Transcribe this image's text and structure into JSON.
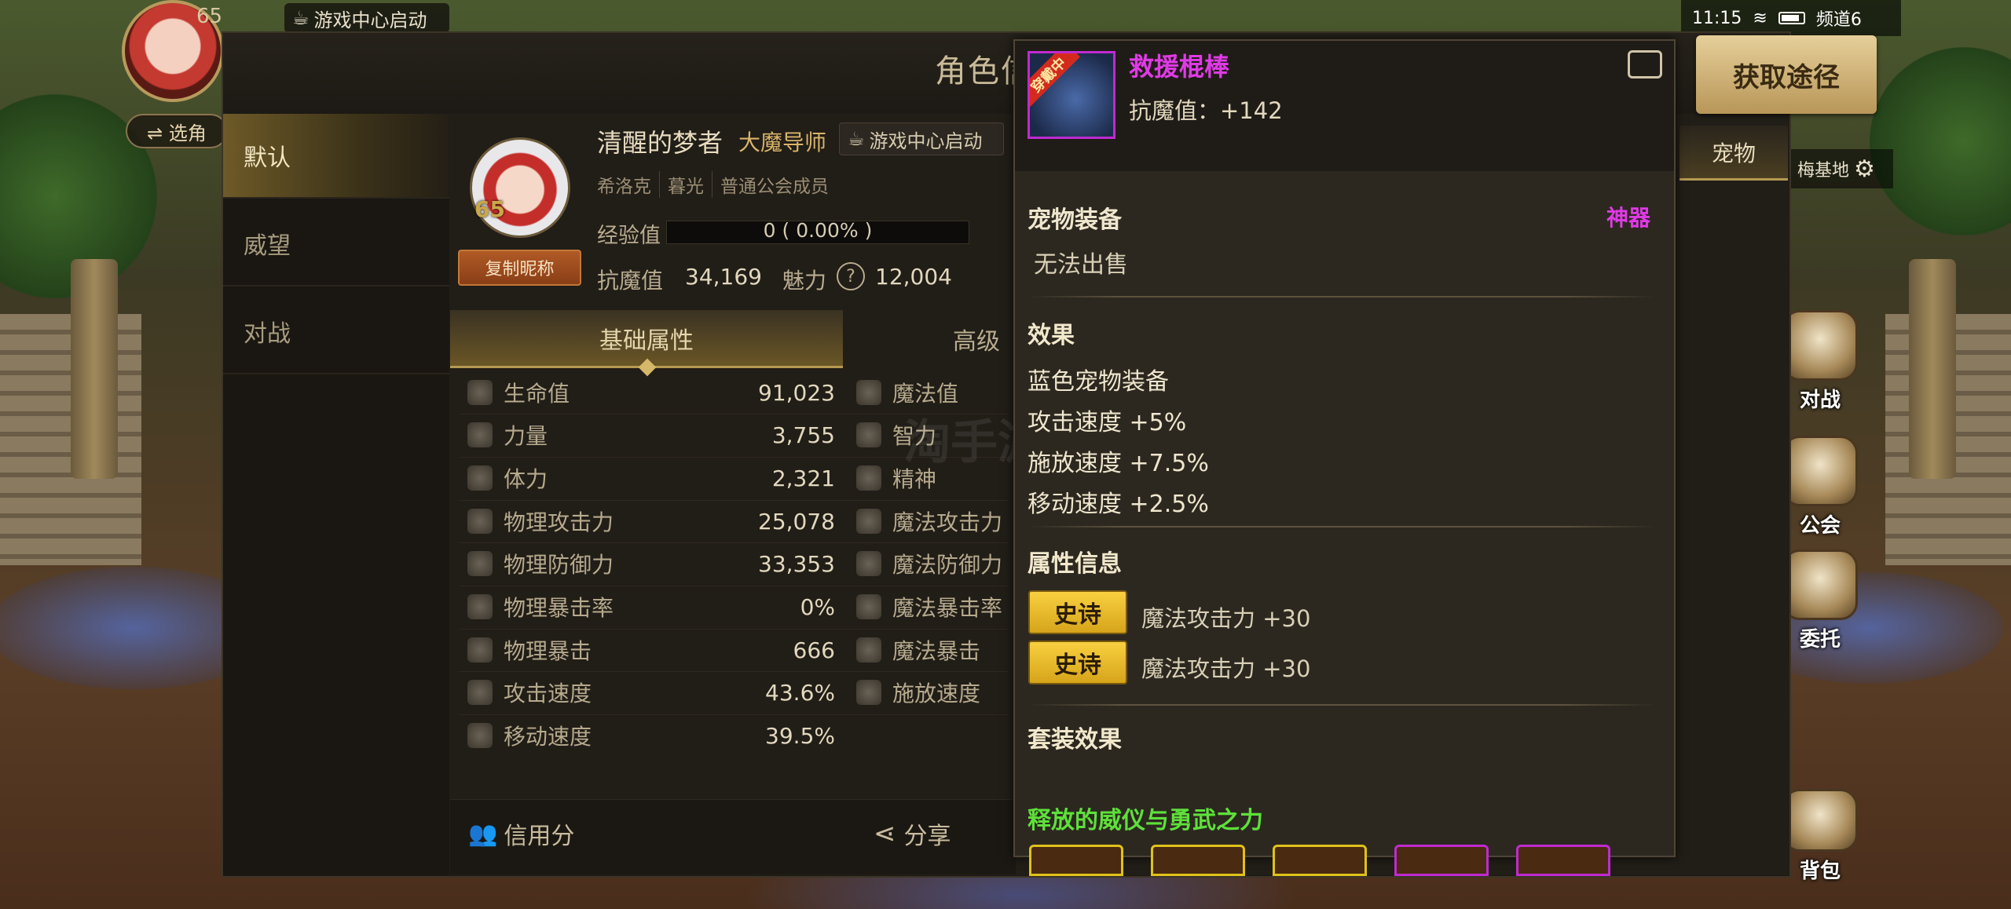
{
  "hud": {
    "level": "65",
    "game_center": "游戏中心启动",
    "select_role": "⇌ 选角"
  },
  "status": {
    "time": "11:15",
    "channel": "频道6"
  },
  "panel": {
    "title": "角色信"
  },
  "side_tabs": [
    {
      "label": "默认"
    },
    {
      "label": "威望"
    },
    {
      "label": "对战"
    }
  ],
  "character": {
    "level": "65",
    "name": "清醒的梦者",
    "class": "大魔导师",
    "game_center": "游戏中心启动",
    "server": "希洛克",
    "guild": "暮光",
    "guild_role": "普通公会成员",
    "copy_nick": "复制昵称",
    "exp_label": "经验值",
    "exp_value": "0 ( 0.00% )",
    "exp_progress": 0,
    "resistance_label": "抗魔值",
    "resistance_value": "34,169",
    "charm_label": "魅力",
    "charm_value": "12,004"
  },
  "attr_tabs": {
    "basic": "基础属性",
    "advanced": "高级"
  },
  "attributes_left": [
    {
      "label": "生命值",
      "value": "91,023"
    },
    {
      "label": "力量",
      "value": "3,755"
    },
    {
      "label": "体力",
      "value": "2,321"
    },
    {
      "label": "物理攻击力",
      "value": "25,078"
    },
    {
      "label": "物理防御力",
      "value": "33,353"
    },
    {
      "label": "物理暴击率",
      "value": "0%"
    },
    {
      "label": "物理暴击",
      "value": "666"
    },
    {
      "label": "攻击速度",
      "value": "43.6%"
    },
    {
      "label": "移动速度",
      "value": "39.5%"
    }
  ],
  "attributes_right": [
    {
      "label": "魔法值"
    },
    {
      "label": "智力"
    },
    {
      "label": "精神"
    },
    {
      "label": "魔法攻击力"
    },
    {
      "label": "魔法防御力"
    },
    {
      "label": "魔法暴击率"
    },
    {
      "label": "魔法暴击"
    },
    {
      "label": "施放速度"
    }
  ],
  "bottom": {
    "credit": "信用分",
    "share": "分享"
  },
  "right_panel": {
    "pet_tab": "宠物",
    "base": "梅基地"
  },
  "acquire_button": "获取途径",
  "item": {
    "ribbon": "穿戴中",
    "name": "救援棍棒",
    "resistance": "抗魔值：+142",
    "category": "宠物装备",
    "rarity": "神器",
    "sell": "无法出售",
    "effect_title": "效果",
    "effects": [
      "蓝色宠物装备",
      "攻击速度 +5%",
      "施放速度 +7.5%",
      "移动速度 +2.5%"
    ],
    "attr_title": "属性信息",
    "attr_lines": [
      {
        "badge": "史诗",
        "text": "魔法攻击力 +30"
      },
      {
        "badge": "史诗",
        "text": "魔法攻击力 +30"
      }
    ],
    "set_title": "套装效果",
    "set_name": "释放的威仪与勇武之力"
  },
  "game_buttons": [
    {
      "label": "对战"
    },
    {
      "label": "公会"
    },
    {
      "label": "委托"
    },
    {
      "label": "背包"
    }
  ],
  "watermark": "淘手游",
  "colors": {
    "item_name": "#e03ae6",
    "rarity": "#e03ae6",
    "set_name": "#5ee03a",
    "epic_badge": "#f8d040",
    "accent_gold": "#b59a52"
  }
}
